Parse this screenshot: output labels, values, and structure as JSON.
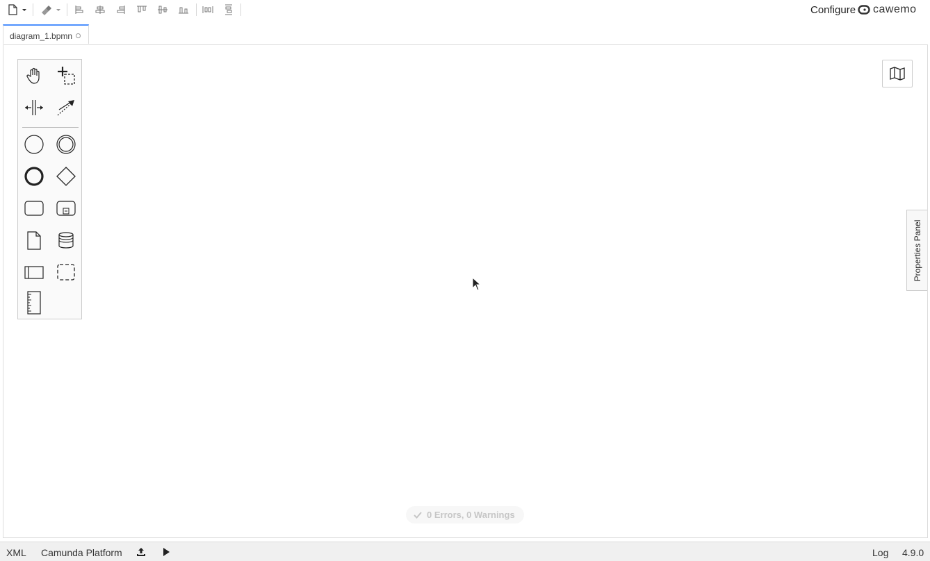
{
  "toolbar": {
    "icons": [
      "new-file-icon",
      "dropdown-icon",
      "paint-format-icon",
      "dropdown-icon",
      "align-left-icon",
      "align-center-icon",
      "align-right-icon",
      "align-top-icon",
      "align-middle-icon",
      "align-bottom-icon",
      "distribute-horizontal-icon",
      "distribute-vertical-icon"
    ],
    "configure_label": "Configure",
    "brand_label": "cawemo"
  },
  "tabs": [
    {
      "label": "diagram_1.bpmn",
      "active": true,
      "unsaved_indicator": true
    }
  ],
  "palette": {
    "tools": [
      "hand-tool",
      "lasso-tool",
      "space-tool",
      "global-connect-tool"
    ],
    "shapes": [
      "start-event",
      "intermediate-event",
      "end-event",
      "gateway",
      "task",
      "subprocess",
      "data-object",
      "data-store",
      "pool-participant",
      "group",
      "text-annotation"
    ]
  },
  "canvas": {
    "properties_panel_label": "Properties Panel",
    "lint_status": "0 Errors, 0 Warnings"
  },
  "statusbar": {
    "xml_label": "XML",
    "platform_label": "Camunda Platform",
    "log_label": "Log",
    "version": "4.9.0"
  },
  "colors": {
    "accent": "#4d90fe",
    "canvas_border": "#dcdcdc",
    "statusbar_bg": "#f0f0f0"
  }
}
